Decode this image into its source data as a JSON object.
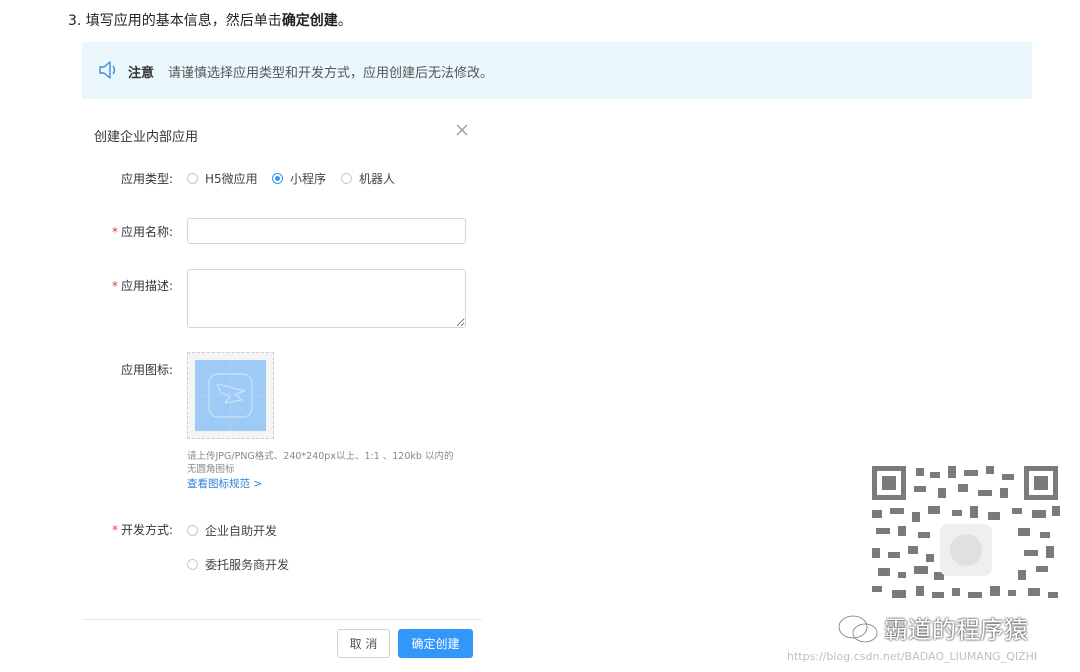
{
  "step": {
    "prefix": "3. 填写应用的基本信息，然后单击",
    "bold": "确定创建",
    "suffix": "。"
  },
  "notice": {
    "title": "注意",
    "text": "请谨慎选择应用类型和开发方式，应用创建后无法修改。",
    "icon": "speaker-icon"
  },
  "dialog": {
    "title": "创建企业内部应用",
    "fields": {
      "type_label": "应用类型:",
      "type_options": [
        "H5微应用",
        "小程序",
        "机器人"
      ],
      "type_selected": "小程序",
      "name_label": "应用名称:",
      "name_value": "",
      "desc_label": "应用描述:",
      "desc_value": "",
      "icon_label": "应用图标:",
      "icon_hint_1": "请上传JPG/PNG格式、240*240px以上、1:1 、120kb 以内的",
      "icon_hint_2": "无圆角图标",
      "icon_link": "查看图标规范 >",
      "dev_label": "开发方式:",
      "dev_options": [
        "企业自助开发",
        "委托服务商开发"
      ],
      "required_mark": "*"
    },
    "buttons": {
      "cancel": "取 消",
      "confirm": "确定创建"
    }
  },
  "watermark": {
    "name": "霸道的程序猿",
    "url": "https://blog.csdn.net/BADAO_LIUMANG_QIZHI"
  },
  "colors": {
    "primary": "#3296fa",
    "notice_bg": "#eaf7fd",
    "required": "#e0403a",
    "link": "#2d7fd8"
  }
}
